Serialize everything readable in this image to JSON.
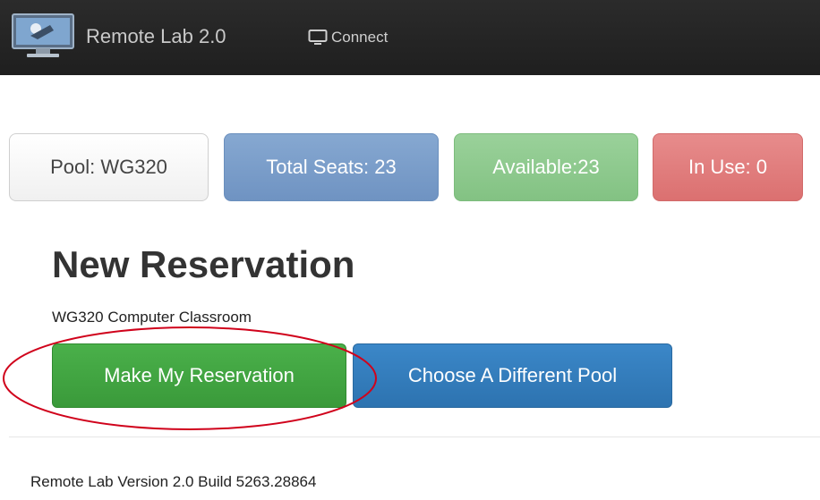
{
  "navbar": {
    "brand_logo_icon": "monitor-logo-icon",
    "brand_text": "Remote Lab 2.0",
    "connect": {
      "icon": "monitor-icon",
      "label": "Connect"
    }
  },
  "stats": {
    "pool": "Pool: WG320",
    "total_seats": "Total Seats: 23",
    "available": "Available:23",
    "in_use": "In Use: 0"
  },
  "reservation": {
    "title": "New Reservation",
    "pool_description": "WG320 Computer Classroom",
    "make_button": "Make My Reservation",
    "choose_pool_button": "Choose A Different Pool"
  },
  "footer": {
    "version_text": "Remote Lab Version 2.0 Build 5263.28864"
  },
  "colors": {
    "navbar_bg": "#222222",
    "total_seats": "#7399c6",
    "available": "#88c488",
    "in_use": "#de7676",
    "make_button": "#43a643",
    "choose_button": "#337ab7",
    "annotation_ellipse": "#d0021b"
  }
}
